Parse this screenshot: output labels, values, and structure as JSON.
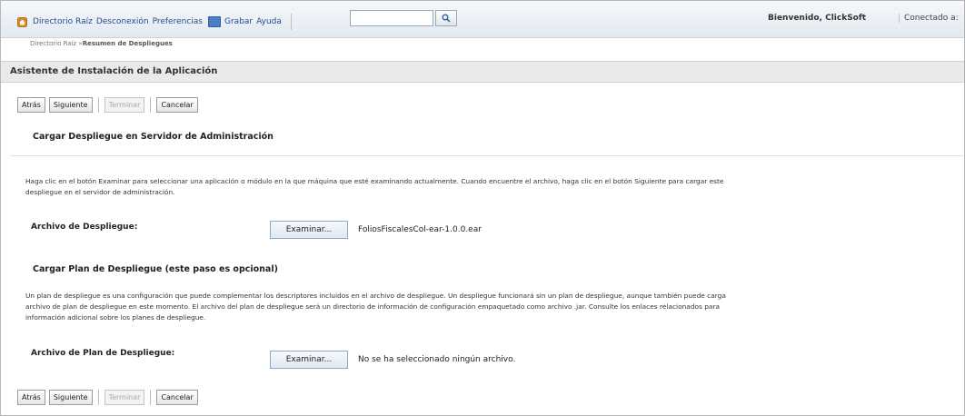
{
  "topbar": {
    "nav": [
      "Directorio Raíz",
      "Desconexión",
      "Preferencias",
      "Grabar",
      "Ayuda"
    ],
    "welcome": "Bienvenido, ClickSoft",
    "connected": "Conectado a:"
  },
  "breadcrumb": {
    "root": "Directorio Raíz",
    "separator": " »",
    "current": "Resumen de Despliegues"
  },
  "wizard": {
    "title": "Asistente de Instalación de la Aplicación",
    "buttons": {
      "back": "Atrás",
      "next": "Siguiente",
      "finish": "Terminar",
      "cancel": "Cancelar"
    }
  },
  "upload_deployment": {
    "heading": "Cargar Despliegue en Servidor de Administración",
    "description_line1": "Haga clic en el botón Examinar para seleccionar una aplicación o módulo en la que máquina que esté examinando actualmente. Cuando encuentre el archivo, haga clic en el botón Siguiente para cargar este",
    "description_line2": "despliegue en el servidor de administración.",
    "field_label": "Archivo de Despliegue:",
    "browse_label": "Examinar...",
    "file_name": "FoliosFiscalesCol-ear-1.0.0.ear"
  },
  "upload_plan": {
    "heading": "Cargar Plan de Despliegue (este paso es opcional)",
    "description_line1": "Un plan de despliegue es una configuración que puede complementar los descriptores incluidos en el archivo de despliegue. Un despliegue funcionará sin un plan de despliegue, aunque también puede carga",
    "description_line2": "archivo de plan de despliegue en este momento. El archivo del plan de despliegue será un directorio de información de configuración empaquetado como archivo .jar. Consulte los enlaces relacionados para",
    "description_line3": "información adicional sobre los planes de despliegue.",
    "field_label": "Archivo de Plan de Despliegue:",
    "browse_label": "Examinar...",
    "file_name": "No se ha seleccionado ningún archivo."
  },
  "colors": {
    "link": "#1e4d8f",
    "header_bg": "#eaeaea"
  }
}
